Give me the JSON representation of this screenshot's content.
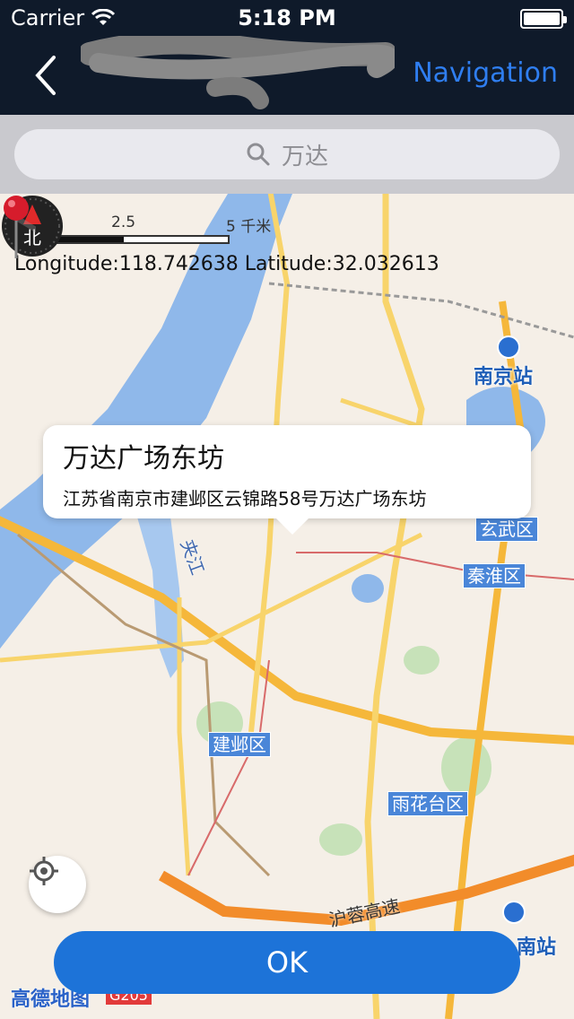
{
  "status_bar": {
    "carrier": "Carrier",
    "time": "5:18 PM",
    "icons": [
      "wifi-icon",
      "battery-icon"
    ]
  },
  "nav": {
    "back_icon": "chevron-left-icon",
    "action_label": "Navigation",
    "action_color": "#2f7ef0"
  },
  "search": {
    "placeholder": "万达",
    "icon": "search-icon"
  },
  "map": {
    "scale": {
      "tick0": "0",
      "tick1": "2.5",
      "tick2": "5 千米"
    },
    "coordinates": "Longitude:118.742638 Latitude:32.032613",
    "compass_label": "北",
    "callout": {
      "title": "万达广场东坊",
      "address": "江苏省南京市建邺区云锦路58号万达广场东坊"
    },
    "labels": {
      "nanjing_station": "南京站",
      "xuanwu": "玄武区",
      "qinhuai": "秦淮区",
      "jianye": "建邺区",
      "yuhuatai": "雨花台区",
      "jiajiang": "夹江",
      "highway": "沪蓉高速",
      "south_station": "南站",
      "brand": "高德地图",
      "shield": "G205"
    }
  },
  "footer": {
    "ok_label": "OK",
    "ok_color": "#1d73d8"
  }
}
